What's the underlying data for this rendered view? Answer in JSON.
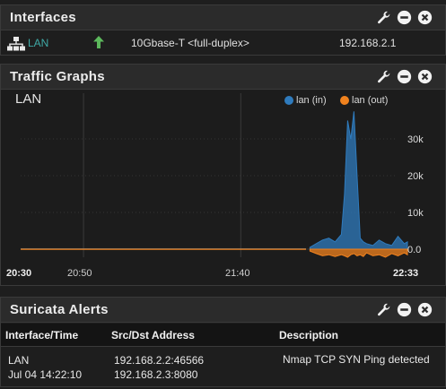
{
  "interfaces": {
    "title": "Interfaces",
    "rows": [
      {
        "name": "LAN",
        "speed": "10Gbase-T <full-duplex>",
        "ip": "192.168.2.1",
        "status": "up"
      }
    ]
  },
  "traffic": {
    "title": "Traffic Graphs",
    "graph_title": "LAN",
    "legend_in": "lan (in)",
    "legend_out": "lan (out)",
    "color_in": "#2f7bbd",
    "color_out": "#f0821e",
    "time_labels": [
      "20:30",
      "20:50",
      "21:40",
      "22:33"
    ],
    "y_labels": [
      "30k",
      "20k",
      "10k",
      "0.0"
    ]
  },
  "chart_data": {
    "type": "area",
    "title": "LAN",
    "xlabel": "",
    "ylabel": "",
    "x_ticks": [
      "20:30",
      "20:50",
      "21:40",
      "22:33"
    ],
    "y_ticks": [
      0,
      10000,
      20000,
      30000
    ],
    "ylim": [
      -2000,
      35000
    ],
    "legend": "top-right",
    "grid": true,
    "series": [
      {
        "name": "lan (in)",
        "x": [
          "22:02",
          "22:04",
          "22:06",
          "22:08",
          "22:10",
          "22:12",
          "22:13",
          "22:14",
          "22:15",
          "22:16",
          "22:17",
          "22:18",
          "22:19",
          "22:20",
          "22:22",
          "22:24",
          "22:26",
          "22:28",
          "22:30",
          "22:32",
          "22:33"
        ],
        "values": [
          500,
          1500,
          2500,
          3000,
          2000,
          4000,
          15000,
          35000,
          30000,
          37500,
          20000,
          3000,
          2000,
          1500,
          1000,
          2500,
          1500,
          1000,
          3500,
          1500,
          2000
        ]
      },
      {
        "name": "lan (out)",
        "x": [
          "22:02",
          "22:04",
          "22:06",
          "22:08",
          "22:10",
          "22:12",
          "22:13",
          "22:14",
          "22:15",
          "22:16",
          "22:17",
          "22:18",
          "22:19",
          "22:20",
          "22:22",
          "22:24",
          "22:26",
          "22:28",
          "22:30",
          "22:32",
          "22:33"
        ],
        "values": [
          -500,
          -1200,
          -1800,
          -1500,
          -2000,
          -1500,
          -1800,
          -2200,
          -1500,
          -1200,
          -1800,
          -1500,
          -2000,
          -1000,
          -1800,
          -1500,
          -2200,
          -1200,
          -1800,
          -1000,
          -1500
        ]
      }
    ]
  },
  "suricata": {
    "title": "Suricata Alerts",
    "columns": [
      "Interface/Time",
      "Src/Dst Address",
      "Description"
    ],
    "rows": [
      {
        "interface": "LAN",
        "time": "Jul 04 14:22:10",
        "src": "192.168.2.2:46566",
        "dst": "192.168.2.3:8080",
        "description": "Nmap TCP SYN Ping detected"
      }
    ]
  },
  "icons": [
    "wrench-icon",
    "minimize-icon",
    "close-icon",
    "network-icon",
    "arrow-up-icon"
  ]
}
